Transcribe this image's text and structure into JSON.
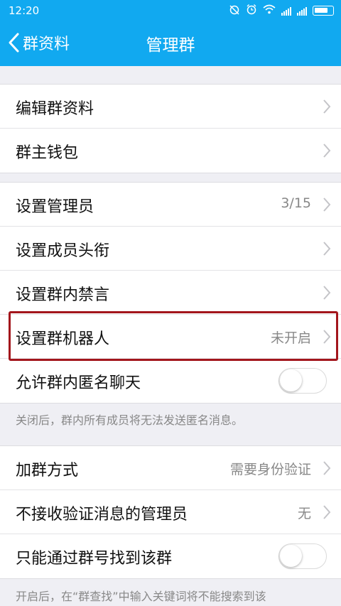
{
  "status_bar": {
    "time": "12:20",
    "icons": [
      "alarm-off-icon",
      "alarm-icon",
      "wifi-icon",
      "signal-icon",
      "signal-icon",
      "battery-icon"
    ]
  },
  "nav": {
    "back_label": "群资料",
    "title": "管理群"
  },
  "group1": [
    {
      "label": "编辑群资料"
    },
    {
      "label": "群主钱包"
    }
  ],
  "group2": [
    {
      "label": "设置管理员",
      "value": "3/15"
    },
    {
      "label": "设置成员头衔"
    },
    {
      "label": "设置群内禁言"
    },
    {
      "label": "设置群机器人",
      "value": "未开启"
    },
    {
      "label": "允许群内匿名聊天",
      "toggle": false
    }
  ],
  "note1": "关闭后，群内所有成员将无法发送匿名消息。",
  "group3": [
    {
      "label": "加群方式",
      "value": "需要身份验证"
    },
    {
      "label": "不接收验证消息的管理员",
      "value": "无"
    },
    {
      "label": "只能通过群号找到该群",
      "toggle": false
    }
  ],
  "note2": "开启后，在“群查找”中输入关键词将不能搜索到该",
  "colors": {
    "header": "#11a9f0",
    "background": "#efeff4",
    "highlight": "#a3161c"
  }
}
